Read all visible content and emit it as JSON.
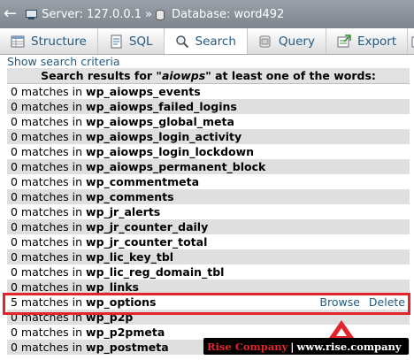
{
  "breadcrumb": {
    "server_label": "Server: 127.0.0.1",
    "separator": "»",
    "database_label": "Database: word492"
  },
  "tabs": [
    {
      "label": "Structure",
      "icon": "structure-icon",
      "active": false
    },
    {
      "label": "SQL",
      "icon": "sql-icon",
      "active": false
    },
    {
      "label": "Search",
      "icon": "search-icon",
      "active": true
    },
    {
      "label": "Query",
      "icon": "query-icon",
      "active": false
    },
    {
      "label": "Export",
      "icon": "export-icon",
      "active": false
    }
  ],
  "search": {
    "show_criteria_link": "Show search criteria",
    "results_heading": "Search results for \"aiowps\" at least one of the words:",
    "rows": [
      {
        "text": "0 matches in ",
        "table": "wp_aiowps_events"
      },
      {
        "text": "0 matches in ",
        "table": "wp_aiowps_failed_logins"
      },
      {
        "text": "0 matches in ",
        "table": "wp_aiowps_global_meta"
      },
      {
        "text": "0 matches in ",
        "table": "wp_aiowps_login_activity"
      },
      {
        "text": "0 matches in ",
        "table": "wp_aiowps_login_lockdown"
      },
      {
        "text": "0 matches in ",
        "table": "wp_aiowps_permanent_block"
      },
      {
        "text": "0 matches in ",
        "table": "wp_commentmeta"
      },
      {
        "text": "0 matches in ",
        "table": "wp_comments"
      },
      {
        "text": "0 matches in ",
        "table": "wp_jr_alerts"
      },
      {
        "text": "0 matches in ",
        "table": "wp_jr_counter_daily"
      },
      {
        "text": "0 matches in ",
        "table": "wp_jr_counter_total"
      },
      {
        "text": "0 matches in ",
        "table": "wp_lic_key_tbl"
      },
      {
        "text": "0 matches in ",
        "table": "wp_lic_reg_domain_tbl"
      },
      {
        "text": "0 matches in ",
        "table": "wp_links"
      },
      {
        "text": "5 matches in ",
        "table": "wp_options",
        "browse": "Browse",
        "delete": "Delete"
      },
      {
        "text": "0 matches in ",
        "table": "wp_p2p"
      },
      {
        "text": "0 matches in ",
        "table": "wp_p2pmeta"
      },
      {
        "text": "0 matches in ",
        "table": "wp_postmeta"
      }
    ]
  },
  "watermark": {
    "brand": "Rise Company",
    "divider": "|",
    "site": "www.rise.company"
  },
  "colors": {
    "link": "#235a81",
    "highlight_border": "#e3242b",
    "row_alt": "#dfdfdf"
  }
}
